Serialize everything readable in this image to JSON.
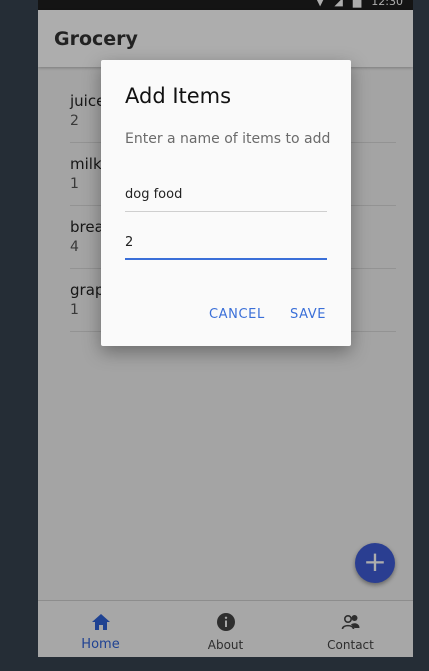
{
  "status_bar": {
    "time": "12:30"
  },
  "app_bar": {
    "title": "Grocery"
  },
  "list": {
    "items": [
      {
        "name": "juice",
        "qty": "2"
      },
      {
        "name": "milk",
        "qty": "1"
      },
      {
        "name": "bread",
        "qty": "4"
      },
      {
        "name": "grapes",
        "qty": "1"
      }
    ]
  },
  "fab": {
    "icon": "plus-icon",
    "label": "+"
  },
  "bottom_nav": {
    "items": [
      {
        "label": "Home",
        "icon": "home-icon",
        "active": true
      },
      {
        "label": "About",
        "icon": "info-icon",
        "active": false
      },
      {
        "label": "Contact",
        "icon": "contacts-icon",
        "active": false
      }
    ]
  },
  "dialog": {
    "title": "Add Items",
    "message": "Enter a name of items to add",
    "name_value": "dog food",
    "qty_value": "2",
    "cancel_label": "CANCEL",
    "save_label": "SAVE"
  },
  "colors": {
    "accent": "#3a6fd8",
    "fab": "#3f5cd6",
    "background": "#252d36"
  }
}
